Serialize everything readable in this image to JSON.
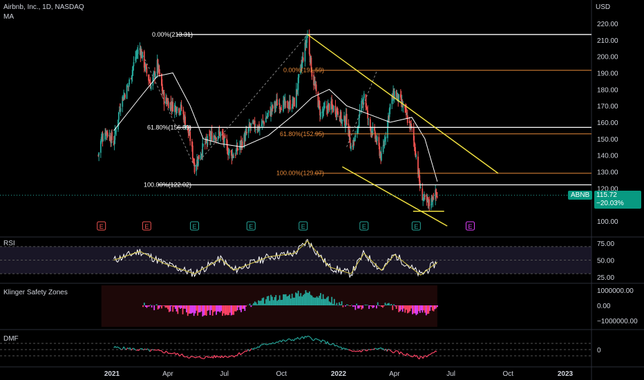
{
  "header": {
    "title": "Airbnb, Inc., 1D, NASDAQ",
    "indicator": "MA"
  },
  "price_axis": {
    "currency": "USD"
  },
  "last_price": {
    "symbol": "ABNB",
    "value": "115.72",
    "change": "−20.03%"
  },
  "colors": {
    "background": "#000000",
    "bull": "#26a69a",
    "bear": "#ef5350",
    "ma": "#ffffff",
    "fib_white": "#ffffff",
    "fib_orange": "#e88a3a",
    "trendline": "#f0e040",
    "rsi": "#ffffff",
    "rsi_ma": "#d8c84a",
    "rsi_band": "#2a2440",
    "klinger_pos": "#26a69a",
    "klinger_neg": "#ff4466",
    "klinger_mag": "#e040fb",
    "klinger_signal": "#2196f3",
    "dmf_pos": "#26a69a",
    "dmf_neg": "#ff4466"
  },
  "chart_data": [
    {
      "type": "candlestick",
      "title": "Airbnb, Inc., 1D, NASDAQ",
      "ylabel": "USD",
      "ylim": [
        95,
        225
      ],
      "y_ticks": [
        "220.00",
        "210.00",
        "200.00",
        "190.00",
        "180.00",
        "170.00",
        "160.00",
        "150.00",
        "140.00",
        "130.00",
        "120.00",
        "110.00",
        "100.00"
      ],
      "x_ticks": [
        "2021",
        "Apr",
        "Jul",
        "Oct",
        "2022",
        "Apr",
        "Jul",
        "Oct",
        "2023"
      ],
      "ohlc_close_path": [
        [
          "2020-12-10",
          140
        ],
        [
          "2020-12-15",
          150
        ],
        [
          "2020-12-22",
          155
        ],
        [
          "2021-01-04",
          148
        ],
        [
          "2021-01-15",
          172
        ],
        [
          "2021-01-28",
          183
        ],
        [
          "2021-02-08",
          200
        ],
        [
          "2021-02-15",
          205
        ],
        [
          "2021-02-26",
          190
        ],
        [
          "2021-03-05",
          182
        ],
        [
          "2021-03-15",
          195
        ],
        [
          "2021-03-26",
          174
        ],
        [
          "2021-04-09",
          170
        ],
        [
          "2021-04-23",
          168
        ],
        [
          "2021-05-07",
          150
        ],
        [
          "2021-05-14",
          133
        ],
        [
          "2021-05-28",
          145
        ],
        [
          "2021-06-11",
          152
        ],
        [
          "2021-06-25",
          153
        ],
        [
          "2021-07-08",
          142
        ],
        [
          "2021-07-16",
          140
        ],
        [
          "2021-07-30",
          148
        ],
        [
          "2021-08-13",
          158
        ],
        [
          "2021-08-27",
          157
        ],
        [
          "2021-09-10",
          165
        ],
        [
          "2021-09-24",
          172
        ],
        [
          "2021-10-08",
          170
        ],
        [
          "2021-10-22",
          172
        ],
        [
          "2021-11-05",
          200
        ],
        [
          "2021-11-12",
          213
        ],
        [
          "2021-11-19",
          190
        ],
        [
          "2021-12-03",
          165
        ],
        [
          "2021-12-17",
          170
        ],
        [
          "2021-12-31",
          167
        ],
        [
          "2022-01-07",
          160
        ],
        [
          "2022-01-14",
          162
        ],
        [
          "2022-01-21",
          145
        ],
        [
          "2022-01-28",
          150
        ],
        [
          "2022-02-11",
          178
        ],
        [
          "2022-02-18",
          160
        ],
        [
          "2022-03-04",
          148
        ],
        [
          "2022-03-11",
          138
        ],
        [
          "2022-03-25",
          170
        ],
        [
          "2022-04-01",
          178
        ],
        [
          "2022-04-14",
          170
        ],
        [
          "2022-04-29",
          155
        ],
        [
          "2022-05-06",
          140
        ],
        [
          "2022-05-13",
          118
        ],
        [
          "2022-05-20",
          112
        ],
        [
          "2022-05-27",
          110
        ],
        [
          "2022-06-03",
          116
        ],
        [
          "2022-06-09",
          115.72
        ]
      ],
      "moving_average": [
        [
          "2021-01-04",
          155
        ],
        [
          "2021-02-15",
          175
        ],
        [
          "2021-03-15",
          188
        ],
        [
          "2021-04-09",
          190
        ],
        [
          "2021-05-07",
          170
        ],
        [
          "2021-05-28",
          150
        ],
        [
          "2021-06-25",
          147
        ],
        [
          "2021-07-30",
          145
        ],
        [
          "2021-09-10",
          152
        ],
        [
          "2021-10-22",
          165
        ],
        [
          "2021-11-19",
          175
        ],
        [
          "2021-12-17",
          180
        ],
        [
          "2022-01-14",
          170
        ],
        [
          "2022-02-18",
          165
        ],
        [
          "2022-03-25",
          160
        ],
        [
          "2022-04-29",
          163
        ],
        [
          "2022-05-20",
          150
        ],
        [
          "2022-06-09",
          124
        ]
      ],
      "fibonacci": [
        {
          "set": "A",
          "level": "0.00%",
          "price": 213.31,
          "label": "0.00%(213.31)"
        },
        {
          "set": "A",
          "level": "61.80%",
          "price": 156.89,
          "label": "61.80%(156.89)"
        },
        {
          "set": "A",
          "level": "100.00%",
          "price": 122.02,
          "label": "100.00%(122.02)"
        },
        {
          "set": "B",
          "level": "0.00%",
          "price": 191.59,
          "label": "0.00%(191.59)"
        },
        {
          "set": "B",
          "level": "61.80%",
          "price": 152.95,
          "label": "61.80%(152.95)"
        },
        {
          "set": "B",
          "level": "100.00%",
          "price": 129.07,
          "label": "100.00%(129.07)"
        }
      ],
      "trendlines": [
        {
          "from": [
            "2021-11-12",
            213.31
          ],
          "to": [
            "2022-09-15",
            129
          ]
        },
        {
          "from": [
            "2022-01-07",
            133
          ],
          "to": [
            "2022-06-25",
            97
          ]
        }
      ],
      "support_level": {
        "price": 106,
        "from": "2022-05-01",
        "to": "2022-06-20"
      },
      "earnings_markers": [
        {
          "date": "2020-12-15",
          "label": "E",
          "color": "#ef5350"
        },
        {
          "date": "2021-02-26",
          "label": "E",
          "color": "#ef5350"
        },
        {
          "date": "2021-05-14",
          "label": "E",
          "color": "#26a69a"
        },
        {
          "date": "2021-08-13",
          "label": "E",
          "color": "#26a69a"
        },
        {
          "date": "2021-11-05",
          "label": "E",
          "color": "#26a69a"
        },
        {
          "date": "2022-02-11",
          "label": "E",
          "color": "#26a69a"
        },
        {
          "date": "2022-05-06",
          "label": "E",
          "color": "#26a69a"
        },
        {
          "date": "2022-08-01",
          "label": "E",
          "color": "#e040fb"
        }
      ]
    },
    {
      "type": "line",
      "title": "RSI",
      "ylim": [
        20,
        80
      ],
      "y_ticks": [
        "75.00",
        "50.00",
        "25.00"
      ],
      "rsi_values": [
        [
          "2021-01-04",
          50
        ],
        [
          "2021-02-15",
          63
        ],
        [
          "2021-03-26",
          45
        ],
        [
          "2021-05-14",
          30
        ],
        [
          "2021-06-25",
          52
        ],
        [
          "2021-07-16",
          35
        ],
        [
          "2021-09-10",
          55
        ],
        [
          "2021-10-22",
          60
        ],
        [
          "2021-11-12",
          78
        ],
        [
          "2021-12-17",
          40
        ],
        [
          "2022-01-21",
          30
        ],
        [
          "2022-02-11",
          60
        ],
        [
          "2022-03-11",
          35
        ],
        [
          "2022-04-01",
          58
        ],
        [
          "2022-05-13",
          28
        ],
        [
          "2022-06-09",
          47
        ]
      ]
    },
    {
      "type": "bar",
      "title": "Klinger Safety Zones",
      "y_ticks": [
        "1000000.00",
        "0.00",
        "−1000000.00"
      ],
      "ylim": [
        -1300000,
        1300000
      ]
    },
    {
      "type": "line",
      "title": "DMF",
      "y_ticks": [
        "0"
      ],
      "ylim": [
        -0.4,
        0.4
      ],
      "dmf_values": [
        [
          "2021-01-04",
          0.05
        ],
        [
          "2021-03-26",
          -0.05
        ],
        [
          "2021-05-14",
          -0.2
        ],
        [
          "2021-07-16",
          -0.15
        ],
        [
          "2021-09-10",
          0.15
        ],
        [
          "2021-11-12",
          0.3
        ],
        [
          "2021-12-17",
          0.15
        ],
        [
          "2022-01-21",
          -0.05
        ],
        [
          "2022-03-11",
          0.02
        ],
        [
          "2022-05-13",
          -0.2
        ],
        [
          "2022-06-09",
          -0.05
        ]
      ]
    }
  ]
}
